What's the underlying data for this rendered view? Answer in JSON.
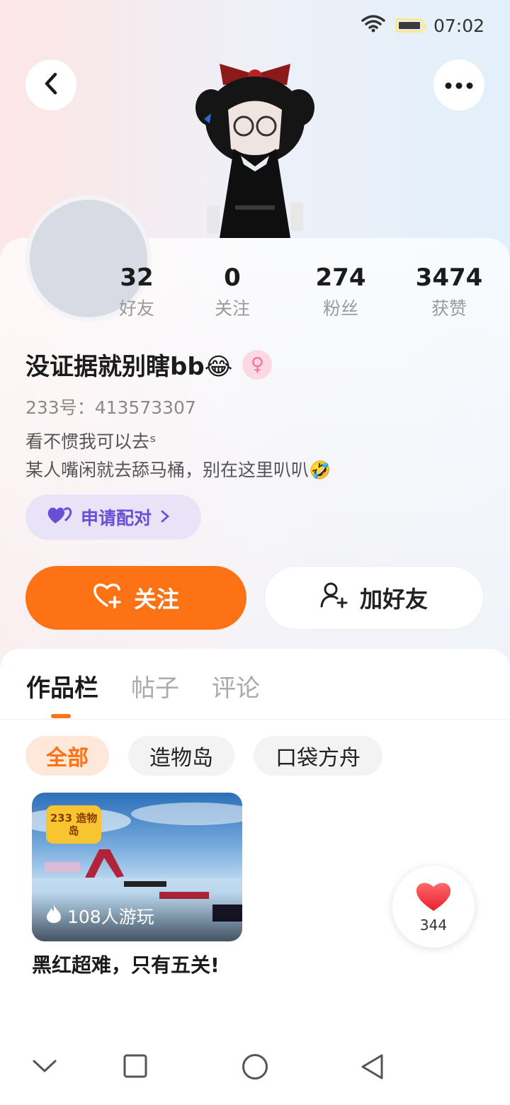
{
  "status_bar": {
    "time": "07:02"
  },
  "stats": [
    {
      "value": "32",
      "label": "好友"
    },
    {
      "value": "0",
      "label": "关注"
    },
    {
      "value": "274",
      "label": "粉丝"
    },
    {
      "value": "3474",
      "label": "获赞"
    }
  ],
  "profile": {
    "nickname": "没证据就别瞎bb😂",
    "gender_symbol": "♀",
    "uid": "233号：413573307",
    "bio_line1": "看不惯我可以去ˢ",
    "bio_line2": "某人嘴闲就去舔马桶，别在这里叭叭🤣"
  },
  "pair_button": {
    "label": "申请配对"
  },
  "actions": {
    "follow_label": "关注",
    "add_friend_label": "加好友"
  },
  "tabs": [
    {
      "label": "作品栏",
      "active": true
    },
    {
      "label": "帖子",
      "active": false
    },
    {
      "label": "评论",
      "active": false
    }
  ],
  "filters": [
    {
      "label": "全部",
      "active": true
    },
    {
      "label": "造物岛",
      "active": false
    },
    {
      "label": "口袋方舟",
      "active": false
    }
  ],
  "works": [
    {
      "badge": "233 造物岛",
      "plays": "108人游玩",
      "title": "黑红超难，只有五关!"
    }
  ],
  "like_button": {
    "count": "344"
  },
  "icons": {
    "back": "back-arrow-icon",
    "more": "more-dots-icon",
    "wifi": "wifi-icon",
    "battery": "battery-icon",
    "heart_pair": "pair-hearts-icon",
    "follow": "heart-plus-icon",
    "add_friend": "add-user-icon",
    "plays": "flame-icon",
    "like": "heart-icon",
    "nav_down": "chevron-down-icon",
    "nav_recent": "square-icon",
    "nav_home": "circle-icon",
    "nav_back": "triangle-back-icon"
  },
  "colors": {
    "accent": "#fc7214",
    "pair_purple": "#6a4fd6",
    "like_red": "#f13a3a"
  }
}
